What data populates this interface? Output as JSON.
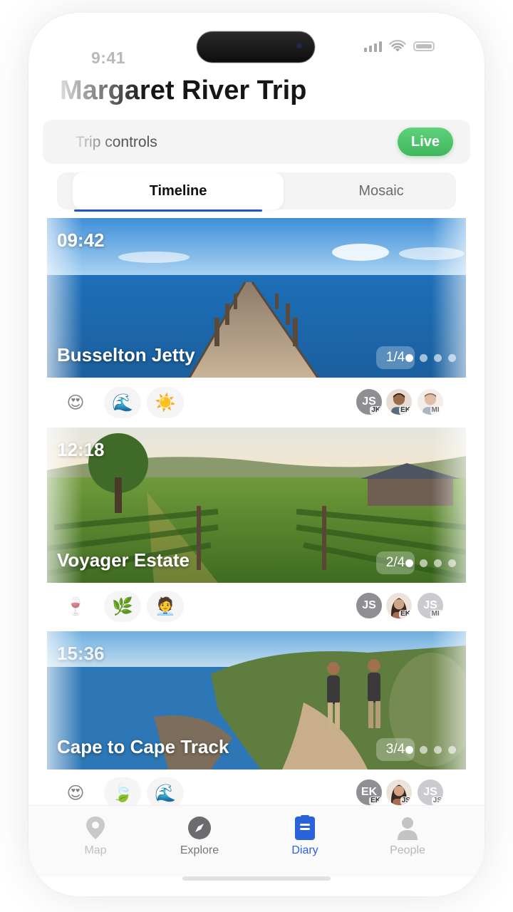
{
  "status_bar": {
    "time": "9:41"
  },
  "header": {
    "title": "Margaret River Trip"
  },
  "controls": {
    "label": "Trip controls",
    "live_label": "Live",
    "live_color": "#46bd63"
  },
  "tabs": [
    {
      "label": "Timeline",
      "active": true
    },
    {
      "label": "Mosaic",
      "active": false
    }
  ],
  "entries": [
    {
      "time": "09:42",
      "place": "Busselton Jetty",
      "counter": "1/4",
      "active_dot": 1,
      "reactions": [
        "😍",
        "🌊",
        "☀️"
      ],
      "avatars": [
        {
          "initials": "JS",
          "sub": "JK",
          "kind": "initials",
          "color": "#8e8e93"
        },
        {
          "initials": "",
          "sub": "EK",
          "kind": "photo-man",
          "color": "#c8a58a"
        },
        {
          "initials": "",
          "sub": "ML",
          "kind": "photo-man2",
          "color": "#d9c4b0"
        }
      ]
    },
    {
      "time": "12:18",
      "place": "Voyager Estate",
      "counter": "2/4",
      "active_dot": 1,
      "reactions": [
        "🍷",
        "🌿",
        "🧑‍💼"
      ],
      "avatars": [
        {
          "initials": "JS",
          "sub": "",
          "kind": "initials",
          "color": "#8e8e93"
        },
        {
          "initials": "",
          "sub": "EK",
          "kind": "photo-woman",
          "color": "#c9a48e"
        },
        {
          "initials": "JS",
          "sub": "ML",
          "kind": "initials",
          "color": "#b6b6bb"
        }
      ]
    },
    {
      "time": "15:36",
      "place": "Cape to Cape Track",
      "counter": "3/4",
      "active_dot": 1,
      "reactions": [
        "😍",
        "🍃",
        "🌊"
      ],
      "avatars": [
        {
          "initials": "EK",
          "sub": "EK",
          "kind": "initials",
          "color": "#8e8e93"
        },
        {
          "initials": "",
          "sub": "JS",
          "kind": "photo-woman",
          "color": "#c9a48e"
        },
        {
          "initials": "JS",
          "sub": "JS",
          "kind": "initials",
          "color": "#b6b6bb"
        }
      ]
    }
  ],
  "tabbar": [
    {
      "label": "Map",
      "icon": "map-pin-icon"
    },
    {
      "label": "Explore",
      "icon": "compass-icon"
    },
    {
      "label": "Diary",
      "icon": "diary-icon",
      "active": true
    },
    {
      "label": "People",
      "icon": "person-icon"
    }
  ]
}
